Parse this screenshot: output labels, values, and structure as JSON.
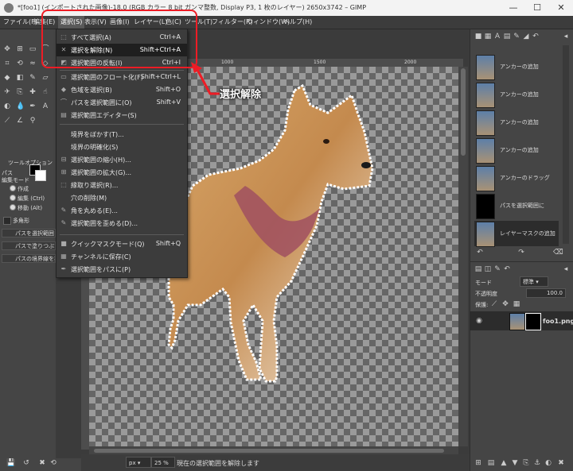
{
  "window": {
    "title": "*[foo1] (インポートされた画像)-18.0 (RGB カラー 8 bit ガンマ整数, Display P3, 1 枚のレイヤー) 2650x3742 – GIMP",
    "controls": {
      "minimize": "—",
      "maximize": "☐",
      "close": "✕"
    }
  },
  "menubar": [
    "ファイル(F)",
    "編集(E)",
    "選択(S)",
    "表示(V)",
    "画像(I)",
    "レイヤー(L)",
    "色(C)",
    "ツール(T)",
    "フィルター(R)",
    "ウィンドウ(W)",
    "ヘルプ(H)"
  ],
  "select_menu": [
    {
      "label": "すべて選択(A)",
      "shortcut": "Ctrl+A"
    },
    {
      "label": "選択を解除(N)",
      "shortcut": "Shift+Ctrl+A"
    },
    {
      "label": "選択範囲の反転(I)",
      "shortcut": "Ctrl+I"
    },
    {
      "label": "選択範囲のフロート化(F)",
      "shortcut": "Shift+Ctrl+L"
    },
    {
      "label": "色域を選択(B)",
      "shortcut": "Shift+O"
    },
    {
      "label": "パスを選択範囲に(O)",
      "shortcut": "Shift+V"
    },
    {
      "label": "選択範囲エディター(S)",
      "shortcut": ""
    },
    {
      "label": "境界をぼかす(T)...",
      "shortcut": ""
    },
    {
      "label": "境界の明確化(S)",
      "shortcut": ""
    },
    {
      "label": "選択範囲の縮小(H)...",
      "shortcut": ""
    },
    {
      "label": "選択範囲の拡大(G)...",
      "shortcut": ""
    },
    {
      "label": "縁取り選択(R)...",
      "shortcut": ""
    },
    {
      "label": "穴の削除(M)",
      "shortcut": ""
    },
    {
      "label": "角を丸める(E)...",
      "shortcut": ""
    },
    {
      "label": "選択範囲を歪める(D)...",
      "shortcut": ""
    },
    {
      "label": "クイックマスクモード(Q)",
      "shortcut": "Shift+Q"
    },
    {
      "label": "チャンネルに保存(C)",
      "shortcut": ""
    },
    {
      "label": "選択範囲をパスに(P)",
      "shortcut": ""
    }
  ],
  "annotation": {
    "label": "選択解除",
    "color": "#ee1c25"
  },
  "ruler": {
    "tick_1000": "1000",
    "tick_1500": "1500",
    "tick_2000": "2000"
  },
  "toolbox": {
    "tool_options_title": "ツールオプション",
    "path_label": "パス",
    "edit_mode_label": "編集モード",
    "mode_design": "作成",
    "mode_edit": "編集 (Ctrl)",
    "mode_move": "移動 (Alt)",
    "polygon_label": "多角形",
    "btn_path_to_sel": "パスを選択範囲",
    "btn_fill_path": "パスで塗りつぶす",
    "btn_stroke_path": "パスの境界線を描"
  },
  "status": {
    "unit": "px",
    "zoom": "25 %",
    "message": "現在の選択範囲を解除します"
  },
  "history": [
    {
      "label": "アンカーの追加",
      "thumb": "photo"
    },
    {
      "label": "アンカーの追加",
      "thumb": "photo"
    },
    {
      "label": "アンカーの追加",
      "thumb": "photo"
    },
    {
      "label": "アンカーの追加",
      "thumb": "photo"
    },
    {
      "label": "アンカーのドラッグ",
      "thumb": "photo"
    },
    {
      "label": "パスを選択範囲に",
      "thumb": "mask"
    },
    {
      "label": "レイヤーマスクの追加",
      "thumb": "photo"
    }
  ],
  "layers": {
    "mode_label": "モード",
    "mode_value": "標準",
    "opacity_label": "不透明度",
    "opacity_value": "100.0",
    "lock_label": "保護:",
    "layer_name": "foo1.png"
  }
}
